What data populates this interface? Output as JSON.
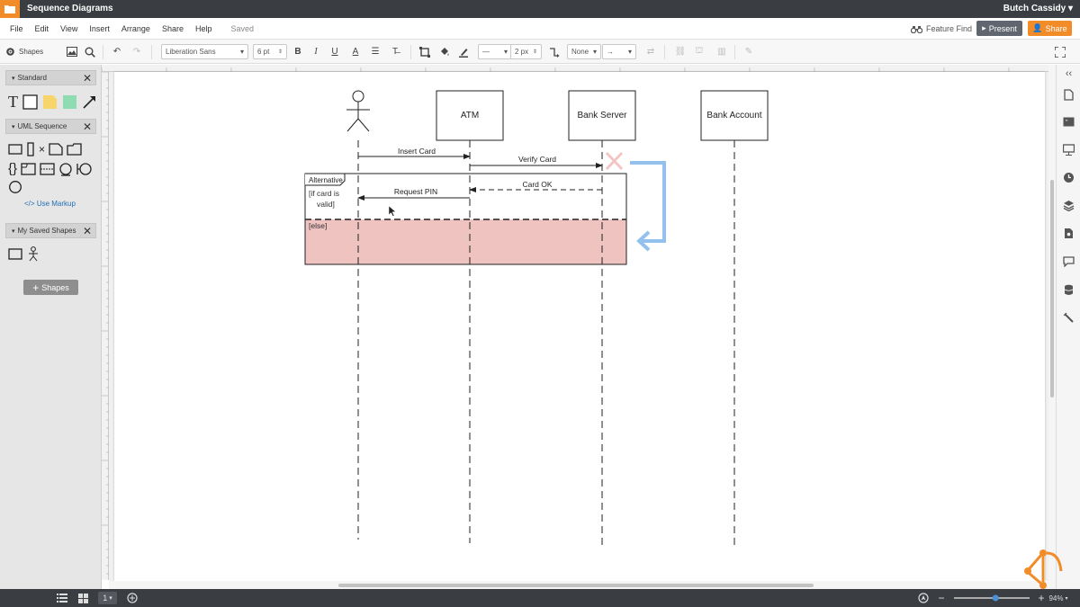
{
  "app": {
    "document_title": "Sequence Diagrams",
    "user_name": "Butch Cassidy",
    "brand_color": "#f28c28"
  },
  "menu": {
    "items": [
      "File",
      "Edit",
      "View",
      "Insert",
      "Arrange",
      "Share",
      "Help"
    ],
    "status": "Saved",
    "feature_find": "Feature Find",
    "present": "Present",
    "share": "Share"
  },
  "toolbar": {
    "shapes_label": "Shapes",
    "font_family": "Liberation Sans",
    "font_size": "6 pt",
    "line_width": "2 px",
    "arrow_start": "None"
  },
  "left_panel": {
    "libraries": [
      {
        "name": "Standard"
      },
      {
        "name": "UML Sequence"
      },
      {
        "name": "My Saved Shapes"
      }
    ],
    "use_markup": "Use Markup",
    "add_shapes": "Shapes"
  },
  "diagram": {
    "participants": [
      {
        "type": "actor",
        "label": ""
      },
      {
        "type": "object",
        "label": "ATM"
      },
      {
        "type": "object",
        "label": "Bank Server"
      },
      {
        "type": "object",
        "label": "Bank Account"
      }
    ],
    "messages": [
      {
        "label": "Insert Card",
        "from": "actor",
        "to": "ATM",
        "style": "solid"
      },
      {
        "label": "Verify Card",
        "from": "ATM",
        "to": "Bank Server",
        "style": "solid"
      },
      {
        "label": "Card OK",
        "from": "Bank Server",
        "to": "ATM",
        "style": "dashed"
      },
      {
        "label": "Request PIN",
        "from": "ATM",
        "to": "actor",
        "style": "solid"
      }
    ],
    "fragment": {
      "label": "Alternative",
      "guard_line1": "[if card is",
      "guard_line2": "valid]",
      "else_label": "[else]",
      "else_fill": "#eec3c0"
    },
    "annotation_arrow_color": "#94c0ee",
    "delete_marker_color": "#f3c5c5"
  },
  "statusbar": {
    "page_number": "1",
    "zoom": "94%",
    "zoom_level": 0.55
  }
}
